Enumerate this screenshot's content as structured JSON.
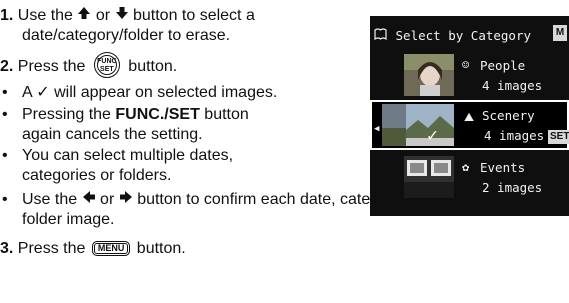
{
  "steps": [
    {
      "num": "1.",
      "pre": "Use the",
      "mid": "or",
      "post": "button to select a",
      "cont": "date/category/folder to erase."
    },
    {
      "num": "2.",
      "pre": "Press the",
      "post": "button."
    },
    {
      "num": "3.",
      "pre": "Press the",
      "post": "button."
    }
  ],
  "bullets": {
    "b1": "A ✓ will appear on selected images.",
    "b2_pre": "Pressing the ",
    "b2_bold": "FUNC./SET",
    "b2_post": " button",
    "b2_cont": "again cancels the setting.",
    "b3": "You can select multiple dates,",
    "b3_cont": "categories or folders.",
    "b4_pre": "Use the",
    "b4_mid": "or",
    "b4_post": "button to confirm each date, category or",
    "b4_cont": "folder image."
  },
  "buttons": {
    "func_top": "FUNC",
    "func_bottom": "SET",
    "menu": "MENU"
  },
  "lcd": {
    "title": "Select by Category",
    "menu_tag": "M",
    "set_tag": "SET",
    "rows": [
      {
        "label": "People",
        "count": "4 images",
        "selected": false
      },
      {
        "label": "Scenery",
        "count": "4 images",
        "selected": true
      },
      {
        "label": "Events",
        "count": "2 images",
        "selected": false
      }
    ]
  }
}
